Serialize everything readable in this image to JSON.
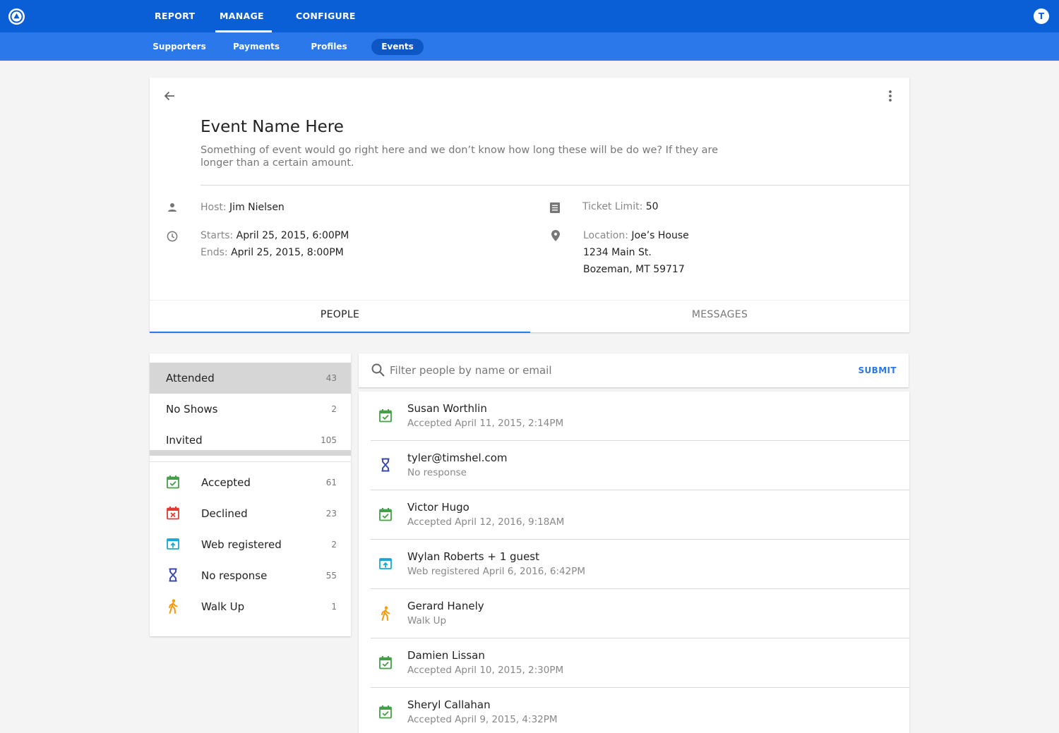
{
  "app": {
    "avatar_initial": "T",
    "brand_color": "#0a5fd6",
    "icon": "logo-icon"
  },
  "topnav": [
    {
      "label": "REPORT"
    },
    {
      "label": "MANAGE",
      "active": true
    },
    {
      "label": "CONFIGURE"
    }
  ],
  "subnav": [
    {
      "label": "Supporters"
    },
    {
      "label": "Payments"
    },
    {
      "label": "Profiles"
    },
    {
      "label": "Events",
      "active": true
    }
  ],
  "event": {
    "title": "Event Name Here",
    "description": "Something of event would go right here and we don’t know how long these will be do we? If they are longer than a certain amount.",
    "host_label": "Host:",
    "host": "Jim Nielsen",
    "starts_label": "Starts:",
    "starts": "April 25, 2015, 6:00PM",
    "ends_label": "Ends:",
    "ends": "April 25, 2015, 8:00PM",
    "ticket_label": "Ticket Limit:",
    "ticket_limit": "50",
    "location_label": "Location:",
    "location_name": "Joe’s House",
    "address_line1": "1234 Main St.",
    "address_line2": "Bozeman, MT 59717"
  },
  "tabs": [
    {
      "label": "PEOPLE",
      "active": true
    },
    {
      "label": "MESSAGES"
    }
  ],
  "filters": {
    "groups": [
      {
        "label": "Attended",
        "count": "43",
        "selected": true
      },
      {
        "label": "No Shows",
        "count": "2"
      },
      {
        "label": "Invited",
        "count": "105"
      }
    ],
    "statuses": [
      {
        "label": "Accepted",
        "count": "61",
        "icon": "calendar-check-icon"
      },
      {
        "label": "Declined",
        "count": "23",
        "icon": "calendar-x-icon"
      },
      {
        "label": "Web registered",
        "count": "2",
        "icon": "web-register-icon"
      },
      {
        "label": "No response",
        "count": "55",
        "icon": "hourglass-icon"
      },
      {
        "label": "Walk Up",
        "count": "1",
        "icon": "walk-icon"
      }
    ]
  },
  "search": {
    "placeholder": "Filter people by name or email",
    "value": "",
    "submit_label": "SUBMIT"
  },
  "people": [
    {
      "name": "Susan Worthlin",
      "status": "Accepted April 11, 2015, 2:14PM",
      "icon": "calendar-check-icon"
    },
    {
      "name": "tyler@timshel.com",
      "status": "No response",
      "icon": "hourglass-icon"
    },
    {
      "name": "Victor Hugo",
      "status": "Accepted April 12, 2016, 9:18AM",
      "icon": "calendar-check-icon"
    },
    {
      "name": "Wylan Roberts + 1 guest",
      "status": "Web registered April 6, 2016, 6:42PM",
      "icon": "web-register-icon"
    },
    {
      "name": "Gerard Hanely",
      "status": "Walk Up",
      "icon": "walk-icon"
    },
    {
      "name": "Damien Lissan",
      "status": "Accepted April 10, 2015, 2:30PM",
      "icon": "calendar-check-icon"
    },
    {
      "name": "Sheryl Callahan",
      "status": "Accepted April 9, 2015, 4:32PM",
      "icon": "calendar-check-icon"
    }
  ],
  "colors": {
    "accepted": "#43a047",
    "declined": "#e53935",
    "web_registered": "#1aa7d6",
    "no_response": "#3949ab",
    "walk_up": "#f59b0b",
    "accent": "#2a78ea"
  }
}
